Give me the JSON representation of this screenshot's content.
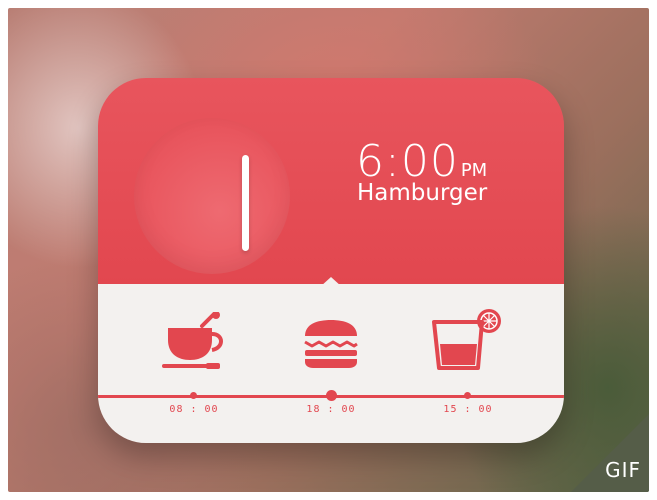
{
  "alarm": {
    "time": "6:00",
    "period": "PM",
    "meal": "Hamburger"
  },
  "schedule": [
    {
      "icon": "coffee-cup-icon",
      "time": "08 : 00"
    },
    {
      "icon": "hamburger-icon",
      "time": "18 : 00"
    },
    {
      "icon": "drink-glass-icon",
      "time": "15 : 00"
    }
  ],
  "badge": "GIF",
  "colors": {
    "accent": "#e2474f",
    "panel": "#f3f1ef",
    "text_on_accent": "#ffffff"
  }
}
